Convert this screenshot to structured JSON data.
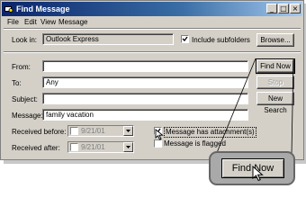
{
  "window": {
    "title": "Find Message",
    "controls": [
      "_",
      "□",
      "×"
    ]
  },
  "menu": [
    "File",
    "Edit",
    "View",
    "Message"
  ],
  "look_in": {
    "label": "Look in:",
    "value": "Outlook Express",
    "include_subfolders_label": "Include subfolders",
    "include_subfolders_checked": true,
    "browse_label": "Browse..."
  },
  "fields": {
    "from_label": "From:",
    "from_value": "",
    "to_label": "To:",
    "to_value": "Any",
    "subject_label": "Subject:",
    "subject_value": "",
    "message_label": "Message:",
    "message_value": "family vacation"
  },
  "buttons": {
    "find_now": "Find Now",
    "stop": "Stop",
    "new_search": "New Search"
  },
  "dates": {
    "before_label": "Received before:",
    "before_value": "9/21/01",
    "after_label": "Received after:",
    "after_value": "9/21/01"
  },
  "options": {
    "has_attachments_label": "Message has attachment(s)",
    "has_attachments_checked": true,
    "flagged_label": "Message is flagged",
    "flagged_checked": false
  },
  "callout": {
    "zoom_label": "Find Now"
  }
}
